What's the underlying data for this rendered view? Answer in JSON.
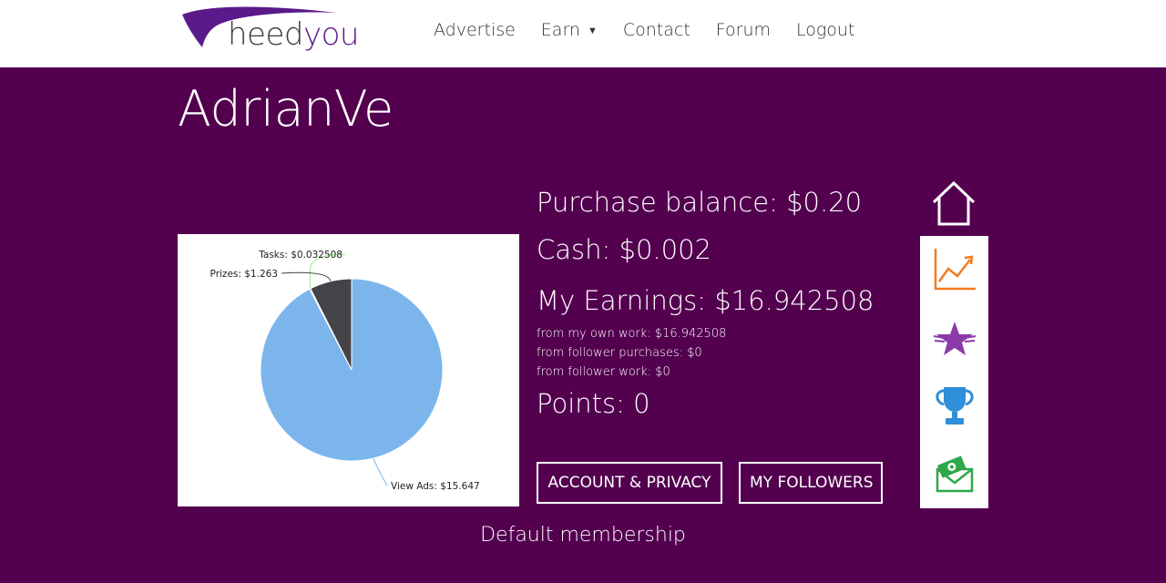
{
  "brand": {
    "logo_part1": "heed",
    "logo_part2": "you",
    "accent": "#53004f"
  },
  "nav": {
    "items": [
      {
        "label": "Advertise"
      },
      {
        "label": "Earn",
        "caret": "▼"
      },
      {
        "label": "Contact"
      },
      {
        "label": "Forum"
      },
      {
        "label": "Logout"
      }
    ]
  },
  "profile": {
    "username": "AdrianVe",
    "membership": "Default membership"
  },
  "stats": {
    "purchase_balance": "Purchase balance: $0.20",
    "cash": "Cash: $0.002",
    "earnings": "My Earnings: $16.942508",
    "from_own_work": "from my own work: $16.942508",
    "from_follower_purchases": "from follower purchases: $0",
    "from_follower_work": "from follower work: $0",
    "points": "Points: 0"
  },
  "buttons": {
    "account_privacy": "ACCOUNT & PRIVACY",
    "my_followers": "MY FOLLOWERS"
  },
  "chart_data": {
    "type": "pie",
    "slices": [
      {
        "label": "View Ads: $15.647",
        "value": 15.647,
        "color": "#7cb5ec",
        "line_color": "#7cb5ec"
      },
      {
        "label": "Tasks: $0.032508",
        "value": 0.032508,
        "color": "#90ed7d",
        "line_color": "#90ed7d"
      },
      {
        "label": "Prizes: $1.263",
        "value": 1.263,
        "color": "#434348",
        "line_color": "#434348"
      }
    ]
  },
  "side_icons": [
    {
      "name": "home-icon",
      "color": "#ffffff"
    },
    {
      "name": "chart-trend-icon",
      "color": "#f47a20"
    },
    {
      "name": "winged-star-icon",
      "color": "#8a3aa8"
    },
    {
      "name": "trophy-icon",
      "color": "#2f8fd8"
    },
    {
      "name": "money-envelope-icon",
      "color": "#2ea84a"
    }
  ]
}
